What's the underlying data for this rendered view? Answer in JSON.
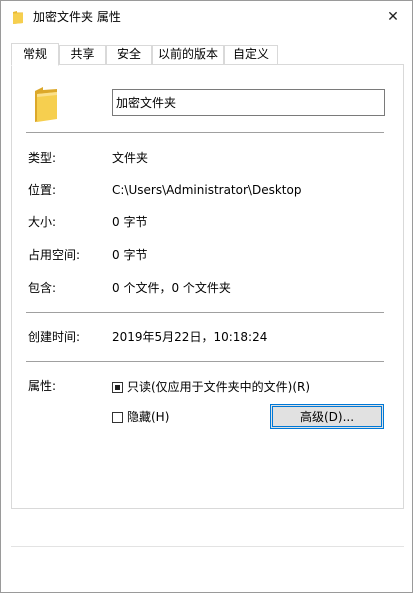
{
  "window": {
    "title": "加密文件夹 属性",
    "close_glyph": "✕",
    "accent_color": "#0078d7",
    "folder_color": "#f3c941"
  },
  "tabs": [
    {
      "label": "常规",
      "active": true
    },
    {
      "label": "共享",
      "active": false
    },
    {
      "label": "安全",
      "active": false
    },
    {
      "label": "以前的版本",
      "active": false
    },
    {
      "label": "自定义",
      "active": false
    }
  ],
  "general": {
    "folder_name": "加密文件夹",
    "type_label": "类型:",
    "type_value": "文件夹",
    "location_label": "位置:",
    "location_value": "C:\\Users\\Administrator\\Desktop",
    "size_label": "大小:",
    "size_value": "0 字节",
    "size_on_disk_label": "占用空间:",
    "size_on_disk_value": "0 字节",
    "contains_label": "包含:",
    "contains_value": "0 个文件，0 个文件夹",
    "created_label": "创建时间:",
    "created_value": "2019年5月22日，10:18:24",
    "attributes_label": "属性:",
    "readonly_label": "只读(仅应用于文件夹中的文件)(R)",
    "readonly_state": "indeterminate",
    "hidden_label": "隐藏(H)",
    "hidden_state": "unchecked",
    "advanced_button": "高级(D)..."
  }
}
